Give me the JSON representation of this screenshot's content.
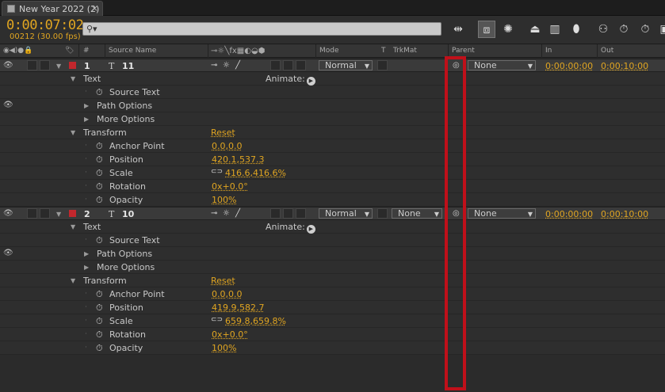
{
  "tab": {
    "title": "New Year 2022 (2)",
    "close": "×"
  },
  "time": {
    "timecode": "0:00:07:02",
    "frames_fps": "00212 (30.00 fps)"
  },
  "search": {
    "placeholder": "",
    "icon": "search-icon"
  },
  "columns": {
    "num": "#",
    "source_name": "Source Name",
    "mode": "Mode",
    "t": "T",
    "trkmat": "TrkMat",
    "parent": "Parent",
    "in": "In",
    "out": "Out"
  },
  "layers": [
    {
      "num": "1",
      "name": "11",
      "mode": "Normal",
      "trkmat": "",
      "parent": "None",
      "in": "0:00:00:00",
      "out": "0:00:10:00",
      "text_group": "Text",
      "animate_label": "Animate:",
      "source_text": "Source Text",
      "path_options": "Path Options",
      "more_options": "More Options",
      "transform": "Transform",
      "reset": "Reset",
      "anchor_point_label": "Anchor Point",
      "anchor_point": "0.0,0.0",
      "position_label": "Position",
      "position": "420.1,537.3",
      "scale_label": "Scale",
      "scale": "416.6,416.6%",
      "rotation_label": "Rotation",
      "rotation": "0x+0.0°",
      "opacity_label": "Opacity",
      "opacity": "100%"
    },
    {
      "num": "2",
      "name": "10",
      "mode": "Normal",
      "trkmat": "None",
      "parent": "None",
      "in": "0:00:00:00",
      "out": "0:00:10:00",
      "text_group": "Text",
      "animate_label": "Animate:",
      "source_text": "Source Text",
      "path_options": "Path Options",
      "more_options": "More Options",
      "transform": "Transform",
      "reset": "Reset",
      "anchor_point_label": "Anchor Point",
      "anchor_point": "0.0,0.0",
      "position_label": "Position",
      "position": "419.9,582.7",
      "scale_label": "Scale",
      "scale": "659.8,659.8%",
      "rotation_label": "Rotation",
      "rotation": "0x+0.0°",
      "opacity_label": "Opacity",
      "opacity": "100%"
    }
  ],
  "colors": {
    "accent": "#e0a521",
    "label_red": "#c2272d",
    "highlight": "#c0101a"
  }
}
